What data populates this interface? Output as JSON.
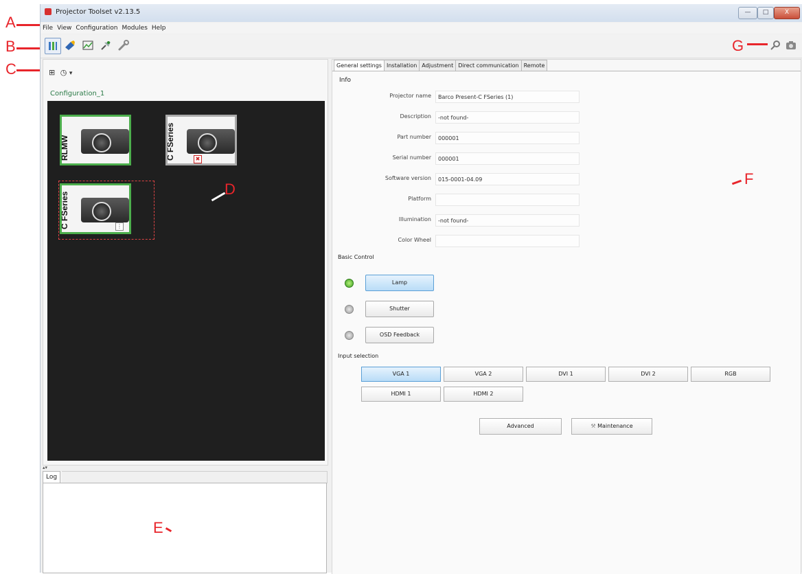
{
  "window": {
    "title": "Projector Toolset v2.13.5",
    "controls": {
      "minimize": "—",
      "maximize": "□",
      "close": "X"
    }
  },
  "annotations": {
    "a": "A",
    "b": "B",
    "c": "C",
    "d": "D",
    "e": "E",
    "f": "F",
    "g": "G"
  },
  "menu": [
    "File",
    "View",
    "Configuration",
    "Modules",
    "Help"
  ],
  "toolbar": {
    "left_icons": [
      "properties-icon",
      "flashlight-icon",
      "chart-icon",
      "satellite-icon",
      "wrench-icon"
    ],
    "right_icons": [
      "search-settings-icon",
      "camera-icon"
    ]
  },
  "left": {
    "tools": {
      "layout_icon": "⊞",
      "clock_icon": "◷",
      "dropdown": "▾"
    },
    "config_title": "Configuration_1",
    "devices": [
      {
        "label": "RLMW",
        "status": "connected",
        "badge": ""
      },
      {
        "label": "C FSeries",
        "status": "disconnected",
        "badge": "✖"
      },
      {
        "label": "C FSeries",
        "status": "connected",
        "badge": "⋮"
      }
    ],
    "splitter": "▴▾"
  },
  "log": {
    "tab_label": "Log"
  },
  "right": {
    "tabs": [
      "General settings",
      "Installation",
      "Adjustment",
      "Direct communication",
      "Remote"
    ],
    "info_heading": "Info",
    "info": [
      {
        "label": "Projector name",
        "value": "Barco Present-C FSeries (1)"
      },
      {
        "label": "Description",
        "value": "-not found-"
      },
      {
        "label": "Part number",
        "value": "000001"
      },
      {
        "label": "Serial number",
        "value": "000001"
      },
      {
        "label": "Software version",
        "value": "015-0001-04.09"
      },
      {
        "label": "Platform",
        "value": ""
      },
      {
        "label": "Illumination",
        "value": "-not found-"
      },
      {
        "label": "Color Wheel",
        "value": ""
      }
    ],
    "basic_control_heading": "Basic Control",
    "basic_controls": [
      {
        "label": "Lamp",
        "on": true
      },
      {
        "label": "Shutter",
        "on": false
      },
      {
        "label": "OSD Feedback",
        "on": false
      }
    ],
    "input_heading": "Input selection",
    "inputs": [
      "VGA 1",
      "VGA 2",
      "DVI 1",
      "DVI 2",
      "RGB",
      "HDMI 1",
      "HDMI 2"
    ],
    "selected_input": "VGA 1",
    "advanced_label": "Advanced",
    "maintenance_label": "Maintenance"
  }
}
